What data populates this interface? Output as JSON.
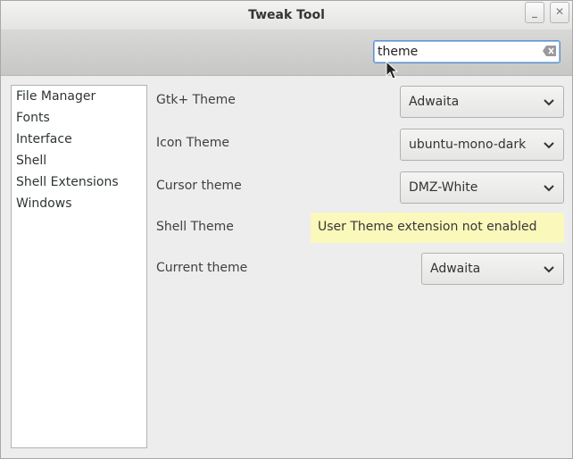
{
  "window": {
    "title": "Tweak Tool",
    "minimize_label": "_",
    "close_label": "✕"
  },
  "search": {
    "value": "theme",
    "placeholder": ""
  },
  "sidebar": {
    "items": [
      {
        "label": "File Manager"
      },
      {
        "label": "Fonts"
      },
      {
        "label": "Interface"
      },
      {
        "label": "Shell"
      },
      {
        "label": "Shell Extensions"
      },
      {
        "label": "Windows"
      }
    ]
  },
  "settings": {
    "gtk_theme": {
      "label": "Gtk+ Theme",
      "value": "Adwaita"
    },
    "icon_theme": {
      "label": "Icon Theme",
      "value": "ubuntu-mono-dark"
    },
    "cursor_theme": {
      "label": "Cursor theme",
      "value": "DMZ-White"
    },
    "shell_theme": {
      "label": "Shell Theme",
      "notice": "User Theme extension not enabled"
    },
    "current_theme": {
      "label": "Current theme",
      "value": "Adwaita"
    }
  },
  "colors": {
    "accent": "#5f93d0",
    "notice_bg": "#fbf8bb"
  },
  "icons": {
    "clear": "edit-clear-icon",
    "dropdown": "chevron-down-icon",
    "cursor": "mouse-pointer-icon"
  }
}
